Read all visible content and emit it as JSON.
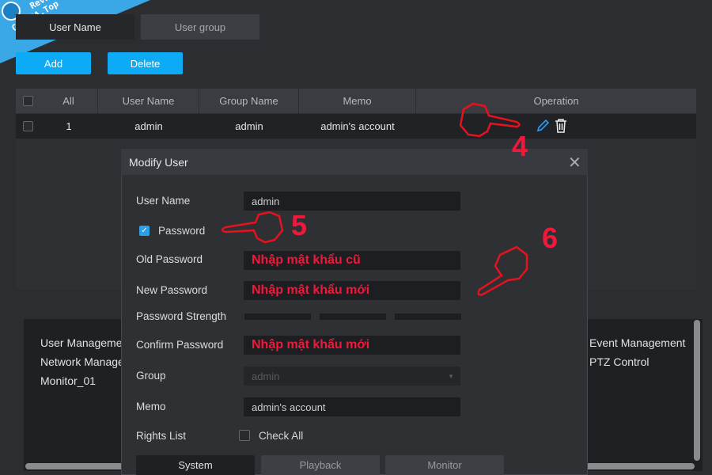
{
  "watermark": {
    "line1": "Review",
    "line2": "CAMERA.Top"
  },
  "tabs": [
    {
      "label": "User Name",
      "active": true
    },
    {
      "label": "User group",
      "active": false
    }
  ],
  "toolbar": {
    "add_label": "Add",
    "delete_label": "Delete"
  },
  "accent": "#0daaf5",
  "table": {
    "headers": [
      "All",
      "User Name",
      "Group Name",
      "Memo",
      "Operation"
    ],
    "rows": [
      {
        "index": "1",
        "user_name": "admin",
        "group_name": "admin",
        "memo": "admin's account"
      }
    ]
  },
  "rights_panel": {
    "left_items": [
      "User Manageme",
      "Network Manage",
      "Monitor_01"
    ],
    "right_items": [
      "Event Management",
      "PTZ Control"
    ]
  },
  "dialog": {
    "title": "Modify User",
    "user_name_label": "User Name",
    "user_name_value": "admin",
    "password_label": "Password",
    "password_checked": true,
    "old_password_label": "Old Password",
    "old_password_value": "Nhập mật khẩu cũ",
    "new_password_label": "New Password",
    "new_password_value": "Nhập mật khẩu mới",
    "strength_label": "Password Strength",
    "confirm_label": "Confirm Password",
    "confirm_value": "Nhập mật khẩu mới",
    "group_label": "Group",
    "group_value": "admin",
    "memo_label": "Memo",
    "memo_value": "admin's account",
    "rights_label": "Rights List",
    "check_all_label": "Check All",
    "tabs": [
      "System",
      "Playback",
      "Monitor"
    ]
  },
  "annotations": {
    "step4": "4",
    "step5": "5",
    "step6": "6",
    "color": "#f0193c"
  }
}
